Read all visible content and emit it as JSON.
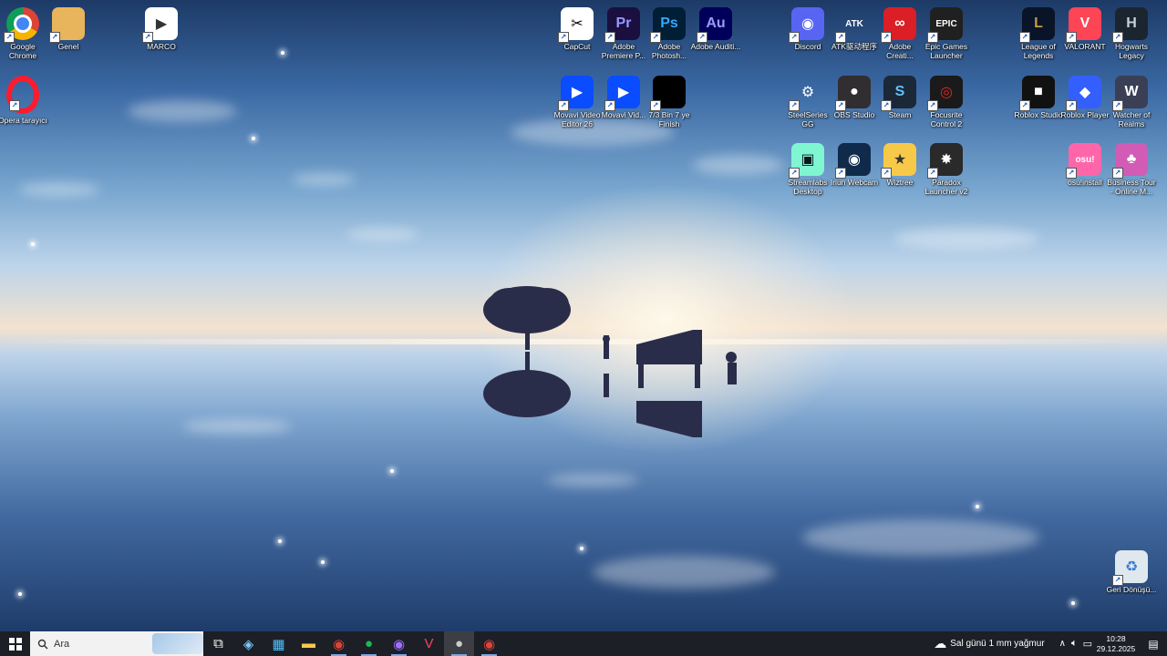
{
  "desktop": {
    "icons": [
      {
        "label": "Google Chrome",
        "glyph": "",
        "bg": "#ffffff",
        "fg": "#db4437",
        "icon": "chrome-icon"
      },
      {
        "label": "Genel",
        "glyph": "",
        "bg": "#e8b45c",
        "fg": "#fff",
        "icon": "folder-icon"
      },
      {
        "label": "MARCO",
        "glyph": "▶",
        "bg": "#ffffff",
        "fg": "#333",
        "icon": "video-file-icon"
      },
      {
        "label": "Opera tarayıcı",
        "glyph": "O",
        "bg": "#ff1b2d",
        "fg": "#fff",
        "icon": "opera-icon"
      },
      {
        "label": "CapCut",
        "glyph": "✂",
        "bg": "#ffffff",
        "fg": "#000",
        "icon": "capcut-icon"
      },
      {
        "label": "Adobe Premiere P...",
        "glyph": "Pr",
        "bg": "#1a0f3f",
        "fg": "#9999ff",
        "icon": "premiere-icon"
      },
      {
        "label": "Adobe Photosh...",
        "glyph": "Ps",
        "bg": "#001e36",
        "fg": "#31a8ff",
        "icon": "photoshop-icon"
      },
      {
        "label": "Adobe Auditi...",
        "glyph": "Au",
        "bg": "#00005b",
        "fg": "#9999ff",
        "icon": "audition-icon"
      },
      {
        "label": "Discord",
        "glyph": "◉",
        "bg": "#5865f2",
        "fg": "#fff",
        "icon": "discord-icon"
      },
      {
        "label": "ATK驱动程序",
        "glyph": "ATK",
        "bg": "transparent",
        "fg": "#fff",
        "icon": "atk-icon"
      },
      {
        "label": "Adobe Creati...",
        "glyph": "∞",
        "bg": "#da1f26",
        "fg": "#fff",
        "icon": "creative-cloud-icon"
      },
      {
        "label": "Epic Games Launcher",
        "glyph": "EPIC",
        "bg": "#202020",
        "fg": "#fff",
        "icon": "epic-games-icon"
      },
      {
        "label": "League of Legends",
        "glyph": "L",
        "bg": "#0a1428",
        "fg": "#c89b3c",
        "icon": "league-icon"
      },
      {
        "label": "VALORANT",
        "glyph": "V",
        "bg": "#fd4556",
        "fg": "#fff",
        "icon": "valorant-icon"
      },
      {
        "label": "Hogwarts Legacy",
        "glyph": "H",
        "bg": "#1b2530",
        "fg": "#c8d0d8",
        "icon": "hogwarts-icon"
      },
      {
        "label": "Movavi Video Editor 26",
        "glyph": "▶",
        "bg": "#0a4cff",
        "fg": "#fff",
        "icon": "movavi-editor-icon"
      },
      {
        "label": "Movavi Vid...",
        "glyph": "▶",
        "bg": "#0a4cff",
        "fg": "#fff",
        "icon": "movavi-icon"
      },
      {
        "label": "7/3 Bin 7 ye Finish",
        "glyph": "",
        "bg": "#000000",
        "fg": "#fff",
        "icon": "video-thumbnail-icon"
      },
      {
        "label": "SteelSeries GG",
        "glyph": "⚙",
        "bg": "transparent",
        "fg": "#fff",
        "icon": "steelseries-icon"
      },
      {
        "label": "OBS Studio",
        "glyph": "●",
        "bg": "#302e31",
        "fg": "#fff",
        "icon": "obs-icon"
      },
      {
        "label": "Steam",
        "glyph": "S",
        "bg": "#1b2838",
        "fg": "#66c0f4",
        "icon": "steam-icon"
      },
      {
        "label": "Focusrite Control 2",
        "glyph": "◎",
        "bg": "#1a1a1a",
        "fg": "#e2261d",
        "icon": "focusrite-icon"
      },
      {
        "label": "Roblox Studio",
        "glyph": "■",
        "bg": "#111111",
        "fg": "#fff",
        "icon": "roblox-studio-icon"
      },
      {
        "label": "Roblox Player",
        "glyph": "◆",
        "bg": "#335fff",
        "fg": "#fff",
        "icon": "roblox-player-icon"
      },
      {
        "label": "Watcher of Realms",
        "glyph": "W",
        "bg": "#3a3f55",
        "fg": "#fff",
        "icon": "watcher-icon"
      },
      {
        "label": "Streamlabs Desktop",
        "glyph": "▣",
        "bg": "#80f5d2",
        "fg": "#09161d",
        "icon": "streamlabs-icon"
      },
      {
        "label": "Iriun Webcam",
        "glyph": "◉",
        "bg": "#0f2a4a",
        "fg": "#fff",
        "icon": "iriun-icon"
      },
      {
        "label": "Wiztree",
        "glyph": "★",
        "bg": "#f7c948",
        "fg": "#333",
        "icon": "wiztree-icon"
      },
      {
        "label": "Paradox Launcher v2",
        "glyph": "✸",
        "bg": "#2a2a2a",
        "fg": "#fff",
        "icon": "paradox-icon"
      },
      {
        "label": "osu!install",
        "glyph": "osu!",
        "bg": "#ff66aa",
        "fg": "#fff",
        "icon": "osu-icon"
      },
      {
        "label": "Business Tour - Online M...",
        "glyph": "♣",
        "bg": "#d25bb5",
        "fg": "#fff",
        "icon": "business-tour-icon"
      },
      {
        "label": "Geri Dönüşü...",
        "glyph": "♻",
        "bg": "#dfe8ef",
        "fg": "#3b7bd1",
        "icon": "recycle-bin-icon"
      }
    ]
  },
  "taskbar": {
    "search_placeholder": "Ara",
    "weather": "Sal günü 1 mm yağmur",
    "time": "10:28",
    "date": "29.12.2025",
    "apps": [
      {
        "icon": "task-view-icon",
        "glyph": "⧉",
        "color": "#ffffff"
      },
      {
        "icon": "copilot-icon",
        "glyph": "◈",
        "color": "#7ec8ff"
      },
      {
        "icon": "store-icon",
        "glyph": "▦",
        "color": "#4cc2ff"
      },
      {
        "icon": "file-explorer-icon",
        "glyph": "▬",
        "color": "#f7c948"
      },
      {
        "icon": "chrome-icon",
        "glyph": "◉",
        "color": "#db4437"
      },
      {
        "icon": "spotify-icon",
        "glyph": "●",
        "color": "#1db954"
      },
      {
        "icon": "messenger-icon",
        "glyph": "◉",
        "color": "#a070ff"
      },
      {
        "icon": "valorant-icon",
        "glyph": "V",
        "color": "#fd4556"
      },
      {
        "icon": "obs-icon",
        "glyph": "●",
        "color": "#cccccc"
      },
      {
        "icon": "chrome-profile-icon",
        "glyph": "◉",
        "color": "#db4437"
      }
    ]
  }
}
